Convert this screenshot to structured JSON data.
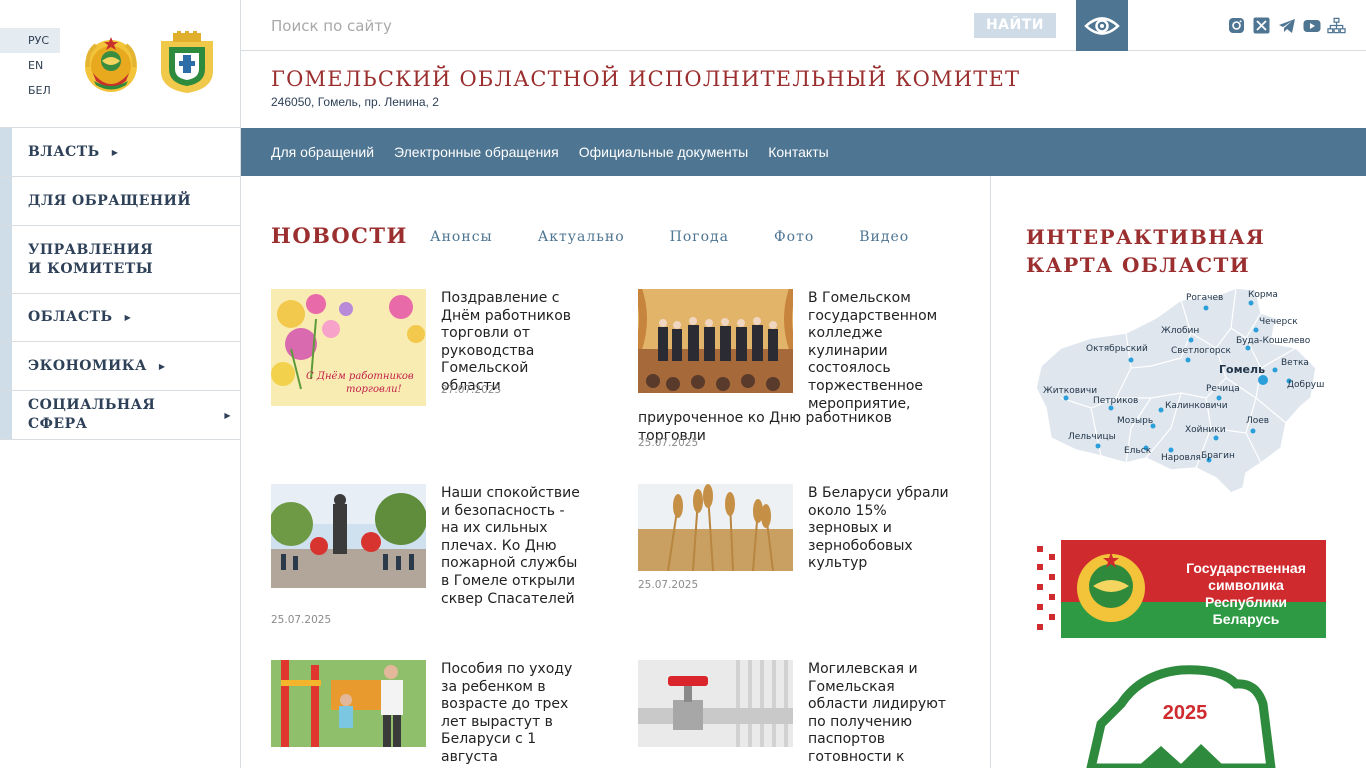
{
  "languages": [
    {
      "label": "РУС",
      "active": true
    },
    {
      "label": "EN",
      "active": false
    },
    {
      "label": "БЕЛ",
      "active": false
    }
  ],
  "search": {
    "placeholder": "Поиск по сайту",
    "button": "НАЙТИ"
  },
  "header": {
    "title": "ГОМЕЛЬСКИЙ ОБЛАСТНОЙ ИСПОЛНИТЕЛЬНЫЙ КОМИТЕТ",
    "address": "246050, Гомель, пр. Ленина, 2"
  },
  "sidebar": {
    "items": [
      {
        "label": "ВЛАСТЬ",
        "has_submenu": true
      },
      {
        "label": "ДЛЯ ОБРАЩЕНИЙ",
        "has_submenu": false
      },
      {
        "label": "УПРАВЛЕНИЯ И КОМИТЕТЫ",
        "has_submenu": false
      },
      {
        "label": "ОБЛАСТЬ",
        "has_submenu": true
      },
      {
        "label": "ЭКОНОМИКА",
        "has_submenu": true
      },
      {
        "label": "СОЦИАЛЬНАЯ СФЕРА",
        "has_submenu": true
      }
    ]
  },
  "main_nav": [
    "Для обращений",
    "Электронные обращения",
    "Официальные документы",
    "Контакты"
  ],
  "news": {
    "heading": "НОВОСТИ",
    "tabs": [
      "Анонсы",
      "Актуально",
      "Погода",
      "Фото",
      "Видео"
    ],
    "items": [
      {
        "title": "Поздравление с Днём работников торговли от руководства Гомельской области",
        "date": "27.07.2025",
        "thumb_caption": "С Днём работников торговли!"
      },
      {
        "title_short": "В Гомельском государственном колледже кулинарии состоялось торжественное мероприятие,",
        "title_tail": "приуроченное ко Дню работников торговли",
        "date": "25.07.2025"
      },
      {
        "title": "Наши спокойствие и безопасность - на их сильных плечах. Ко Дню пожарной службы в Гомеле открыли сквер Спасателей",
        "date": "25.07.2025"
      },
      {
        "title": "В Беларуси убрали около 15% зерновых и зернобобовых культур",
        "date": "25.07.2025"
      },
      {
        "title": "Пособия по уходу за ребенком в возрасте до трех лет вырастут в Беларуси с 1 августа",
        "date": ""
      },
      {
        "title": "Могилевская и Гомельская области лидируют по получению паспортов готовности к",
        "date": ""
      }
    ]
  },
  "map": {
    "heading": "ИНТЕРАКТИВНАЯ КАРТА ОБЛАСТИ",
    "fill_color": "#dfe6ee",
    "dot_color": "#2b9fd9",
    "cities": [
      "Рогачев",
      "Корма",
      "Чечерск",
      "Жлобин",
      "Буда-Кошелево",
      "Октябрьский",
      "Светлогорск",
      "Гомель",
      "Ветка",
      "Добруш",
      "Житковичи",
      "Речица",
      "Петриков",
      "Калинковичи",
      "Мозырь",
      "Лоев",
      "Хойники",
      "Лельчицы",
      "Ельск",
      "Наровля",
      "Брагин"
    ]
  },
  "banner": {
    "line1": "Государственная",
    "line2": "символика",
    "line3": "Республики Беларусь"
  },
  "badge": {
    "year": "2025"
  },
  "colors": {
    "accent_red": "#9b2f2f",
    "nav_blue": "#4e7592",
    "sidebar_stripe": "#cfdde9"
  }
}
